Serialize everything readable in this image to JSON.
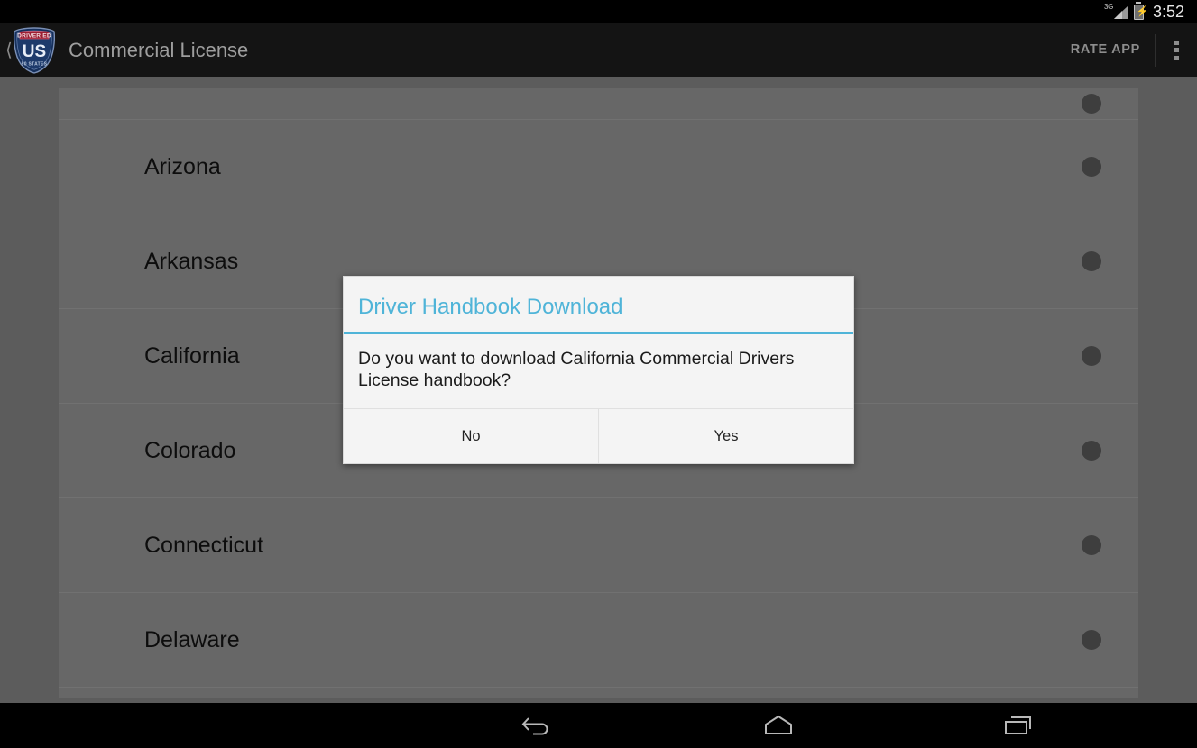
{
  "status_bar": {
    "network_label": "3G",
    "signal_icon": "signal-bars-icon",
    "battery_icon": "battery-charging-icon",
    "clock": "3:52"
  },
  "action_bar": {
    "up_icon": "back-caret-icon",
    "logo_icon": "us-driver-ed-shield-logo",
    "logo_text": {
      "banner": "DRIVER ED",
      "main": "US",
      "sub": "50 STATES"
    },
    "title": "Commercial License",
    "rate_app_label": "RATE APP",
    "overflow_icon": "overflow-menu-icon"
  },
  "list": {
    "rows": [
      {
        "label": "",
        "partial": true,
        "indicator": "download-status-dot"
      },
      {
        "label": "Arizona",
        "partial": false,
        "indicator": "download-status-dot"
      },
      {
        "label": "Arkansas",
        "partial": false,
        "indicator": "download-status-dot"
      },
      {
        "label": "California",
        "partial": false,
        "indicator": "download-status-dot"
      },
      {
        "label": "Colorado",
        "partial": false,
        "indicator": "download-status-dot"
      },
      {
        "label": "Connecticut",
        "partial": false,
        "indicator": "download-status-dot"
      },
      {
        "label": "Delaware",
        "partial": false,
        "indicator": "download-status-dot"
      }
    ]
  },
  "dialog": {
    "title": "Driver Handbook Download",
    "message": "Do you want to download California Commercial Drivers License handbook?",
    "negative_label": "No",
    "positive_label": "Yes",
    "accent_color": "#4fb4d8"
  },
  "nav_bar": {
    "back_icon": "back-arrow-icon",
    "home_icon": "home-icon",
    "recents_icon": "recent-apps-icon"
  },
  "colors": {
    "accent": "#4fb4d8",
    "action_bar": "#141414",
    "page_background": "#5c5c5c",
    "list_background": "#676767",
    "dialog_background": "#f4f4f4"
  }
}
